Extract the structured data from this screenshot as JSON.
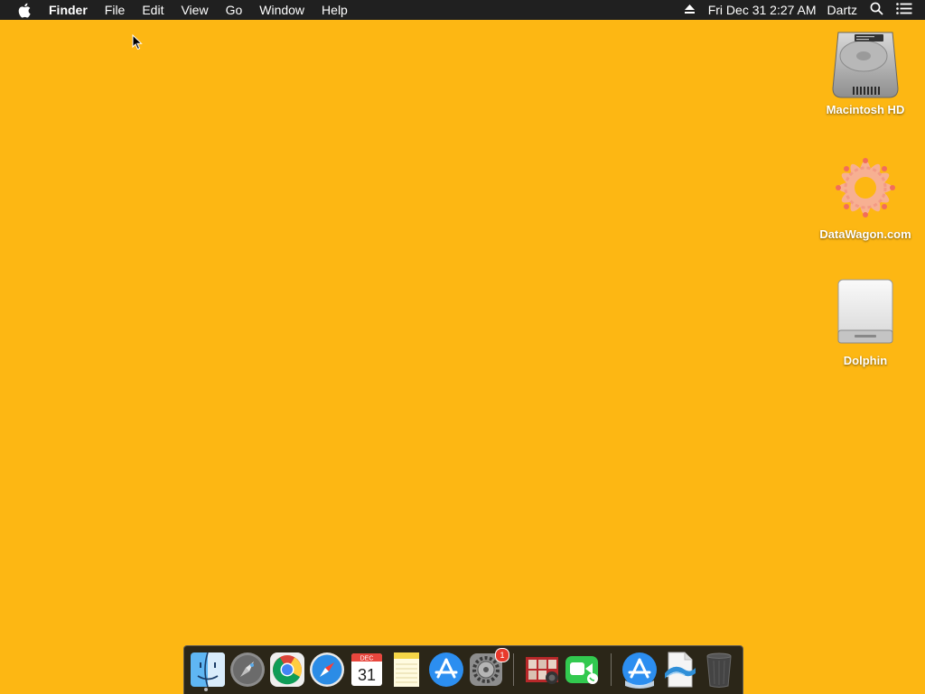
{
  "menubar": {
    "app_name": "Finder",
    "menus": [
      "File",
      "Edit",
      "View",
      "Go",
      "Window",
      "Help"
    ],
    "clock": "Fri Dec 31  2:27 AM",
    "user": "Dartz",
    "icons": [
      "apple-icon",
      "eject-icon",
      "spotlight-search-icon",
      "notification-center-icon"
    ]
  },
  "desktop": {
    "background_color": "#FDB713",
    "icons": [
      {
        "label": "Macintosh HD",
        "icon": "hard-drive-icon"
      },
      {
        "label": "DataWagon.com",
        "icon": "datawagon-image-icon"
      },
      {
        "label": "Dolphin",
        "icon": "external-drive-icon"
      }
    ]
  },
  "dock": {
    "items": [
      {
        "name": "Finder",
        "icon": "finder-icon",
        "running": true
      },
      {
        "name": "Launchpad",
        "icon": "launchpad-icon"
      },
      {
        "name": "Google Chrome",
        "icon": "chrome-icon"
      },
      {
        "name": "Safari",
        "icon": "safari-icon"
      },
      {
        "name": "Calendar",
        "icon": "calendar-icon",
        "month": "DEC",
        "day": "31"
      },
      {
        "name": "Notes",
        "icon": "notes-icon"
      },
      {
        "name": "App Store",
        "icon": "app-store-icon"
      },
      {
        "name": "System Preferences",
        "icon": "system-preferences-icon",
        "badge": "1"
      },
      {
        "name": "Photo Booth",
        "icon": "photo-booth-icon"
      },
      {
        "name": "FaceTime",
        "icon": "facetime-icon"
      },
      {
        "name": "Applications",
        "icon": "applications-folder-icon"
      },
      {
        "name": "Document",
        "icon": "document-icon"
      },
      {
        "name": "Trash",
        "icon": "trash-icon"
      }
    ]
  }
}
